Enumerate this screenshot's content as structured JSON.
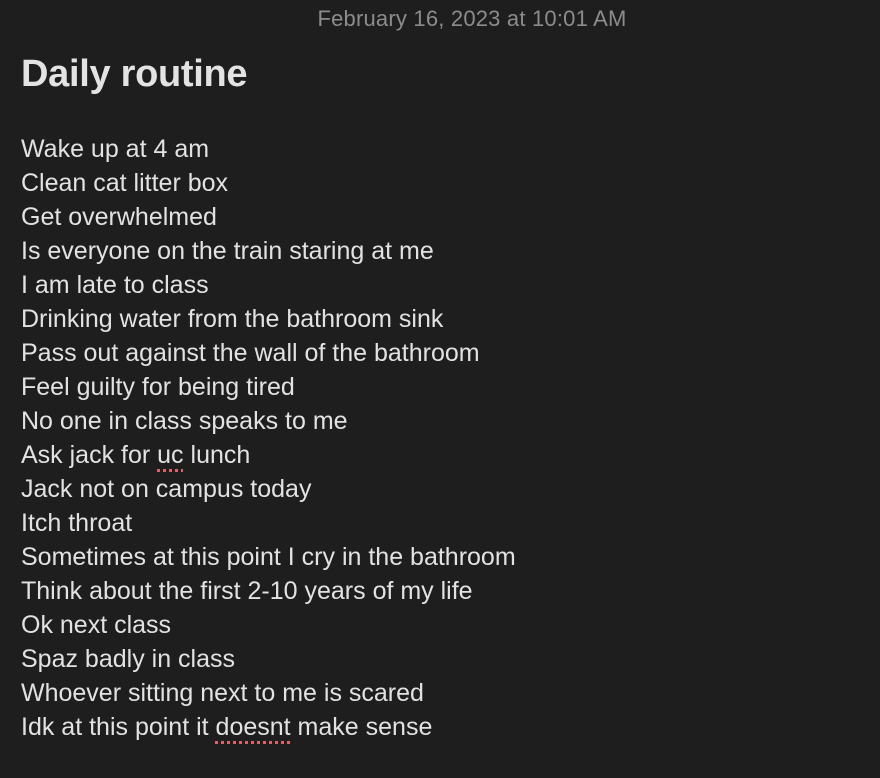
{
  "note": {
    "timestamp": "February 16, 2023 at 10:01 AM",
    "title": "Daily routine",
    "lines": [
      "Wake up at 4 am",
      "Clean cat litter box",
      "Get overwhelmed",
      "Is everyone on the train staring at me",
      "I am late to class",
      "Drinking water from the bathroom sink",
      "Pass out against the wall of the bathroom",
      "Feel guilty for being tired",
      "No one in class speaks to me",
      {
        "pre": "Ask jack for ",
        "misspelled": "uc",
        "post": " lunch"
      },
      "Jack not on campus today",
      "Itch throat",
      "Sometimes at this point I cry in the bathroom",
      "Think about the first 2-10 years of my life",
      "Ok next class",
      "Spaz badly in class",
      "Whoever sitting next to me is scared",
      {
        "pre": "Idk at this point it ",
        "misspelled": "doesnt",
        "post": " make sense"
      }
    ]
  },
  "colors": {
    "background": "#1e1e1e",
    "text": "#e2e2e2",
    "timestamp": "#8c8c8c",
    "spellcheck_underline": "#d9636b"
  }
}
